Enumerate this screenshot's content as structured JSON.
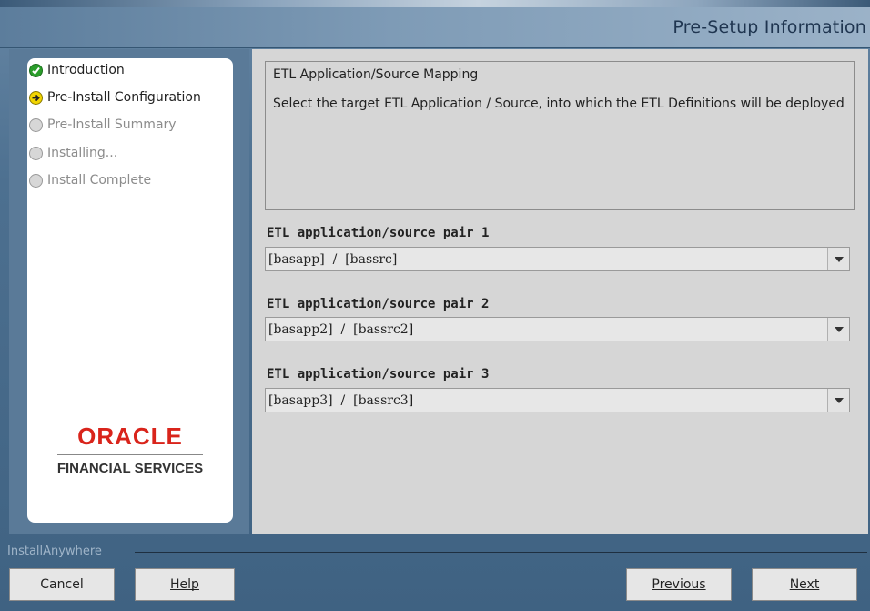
{
  "header": {
    "title": "Pre-Setup Information"
  },
  "steps": [
    {
      "label": "Introduction",
      "state": "done"
    },
    {
      "label": "Pre-Install Configuration",
      "state": "current"
    },
    {
      "label": "Pre-Install Summary",
      "state": "pending"
    },
    {
      "label": "Installing...",
      "state": "pending"
    },
    {
      "label": "Install Complete",
      "state": "pending"
    }
  ],
  "logo": {
    "brand": "ORACLE",
    "sub": "FINANCIAL SERVICES"
  },
  "info": {
    "heading": "ETL Application/Source Mapping",
    "description": "Select the target ETL Application / Source, into which the ETL Definitions will be deployed"
  },
  "fields": [
    {
      "label": "ETL application/source pair 1",
      "value": "[basapp]  /  [bassrc]"
    },
    {
      "label": "ETL application/source pair 2",
      "value": "[basapp2]  /  [bassrc2]"
    },
    {
      "label": "ETL application/source pair 3",
      "value": "[basapp3]  /  [bassrc3]"
    }
  ],
  "footer": {
    "brand_label": "InstallAnywhere"
  },
  "buttons": {
    "cancel": "Cancel",
    "help": "Help",
    "previous": "Previous",
    "next": "Next"
  },
  "colors": {
    "accent_red": "#d9241b",
    "done_green": "#2a9d2a",
    "current_yellow": "#f1d400"
  }
}
